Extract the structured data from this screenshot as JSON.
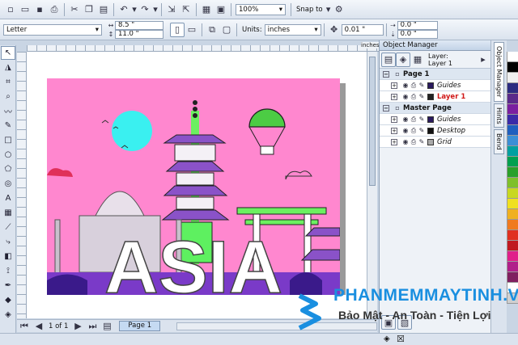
{
  "toolbar1": {
    "zoom": "100%",
    "snap_to": "Snap to"
  },
  "toolbar2": {
    "paper": "Letter",
    "width": "8.5 \"",
    "height": "11.0 \"",
    "units_label": "Units:",
    "units": "inches",
    "nudge": "0.01 \"",
    "dup_x": "0.0 \"",
    "dup_y": "0.0 \""
  },
  "ruler": {
    "units": "inches"
  },
  "artwork": {
    "title": "ASIA"
  },
  "page_nav": {
    "position": "1 of 1",
    "tab": "Page 1"
  },
  "object_manager": {
    "title": "Object Manager",
    "layer_label": "Layer:",
    "layer_name": "Layer 1",
    "rows": [
      {
        "label": "Page 1",
        "type": "header"
      },
      {
        "label": "Guides",
        "type": "layer",
        "color": "#2a1a5e"
      },
      {
        "label": "Layer 1",
        "type": "active",
        "color": "#222222"
      },
      {
        "label": "Master Page",
        "type": "header"
      },
      {
        "label": "Guides",
        "type": "layer",
        "color": "#2a1a5e"
      },
      {
        "label": "Desktop",
        "type": "layer",
        "color": "#111111"
      },
      {
        "label": "Grid",
        "type": "layer",
        "color": "#aaaaaa"
      }
    ]
  },
  "side_tabs": [
    "Object Manager",
    "Hints",
    "Bend"
  ],
  "palette": [
    "#ffffff",
    "#000000",
    "#f0f0f0",
    "#2b2b80",
    "#5a2a8a",
    "#7a1fa0",
    "#3a2aa8",
    "#1f5fbf",
    "#3b8fd6",
    "#00a0a0",
    "#00a050",
    "#2aa02a",
    "#7fc02a",
    "#c8d820",
    "#f0e020",
    "#f0b020",
    "#f07a20",
    "#e03020",
    "#c01820",
    "#e0208a",
    "#b0208a",
    "#802060",
    "#ffffff",
    "#d0d0d0"
  ],
  "watermark": {
    "site": "PHANMEMMAYTINH.VN",
    "slogan": "Bảo Mật - An Toàn - Tiện Lợi"
  }
}
